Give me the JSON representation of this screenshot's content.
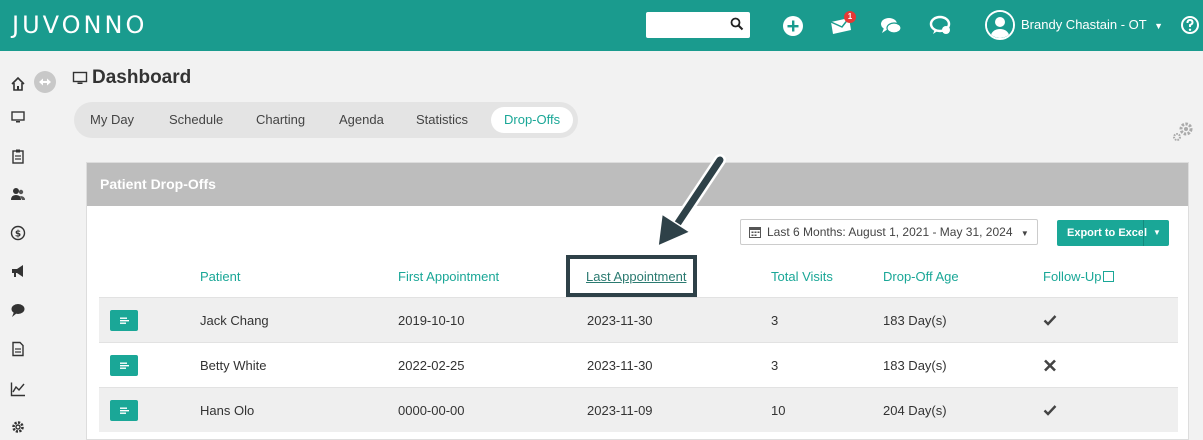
{
  "app": {
    "logo": "JUVONNO",
    "notification_count": "1",
    "user_name": "Brandy Chastain - OT",
    "accent": "#1aa797",
    "topbar_color": "#1a9b8e"
  },
  "header": {
    "title": "Dashboard"
  },
  "tabs": [
    {
      "label": "My Day"
    },
    {
      "label": "Schedule"
    },
    {
      "label": "Charting"
    },
    {
      "label": "Agenda"
    },
    {
      "label": "Statistics"
    },
    {
      "label": "Drop-Offs"
    }
  ],
  "active_tab": "Drop-Offs",
  "panel": {
    "title": "Patient Drop-Offs",
    "date_range": "Last 6 Months: August 1, 2021 - May 31, 2024",
    "export_label": "Export to Excel",
    "columns": [
      "Patient",
      "First Appointment",
      "Last Appointment",
      "Total Visits",
      "Drop-Off Age",
      "Follow-Up"
    ],
    "sorted_column": "Last Appointment",
    "rows": [
      {
        "patient": "Jack Chang",
        "first": "2019-10-10",
        "last": "2023-11-30",
        "visits": "3",
        "age": "183 Day(s)",
        "follow_up": "check"
      },
      {
        "patient": "Betty White",
        "first": "2022-02-25",
        "last": "2023-11-30",
        "visits": "3",
        "age": "183 Day(s)",
        "follow_up": "cross"
      },
      {
        "patient": "Hans Olo",
        "first": "0000-00-00",
        "last": "2023-11-09",
        "visits": "10",
        "age": "204 Day(s)",
        "follow_up": "check"
      }
    ]
  },
  "icons": {
    "sidebar": [
      "home-icon",
      "monitor-icon",
      "clipboard-icon",
      "users-icon",
      "dollar-icon",
      "megaphone-icon",
      "chat-icon",
      "document-icon",
      "chart-icon",
      "gear-icon"
    ],
    "topbar": [
      "search-icon",
      "plus-circle-icon",
      "envelope-icon",
      "chat-bubbles-icon",
      "feedback-icon",
      "user-avatar-icon",
      "help-icon"
    ]
  }
}
